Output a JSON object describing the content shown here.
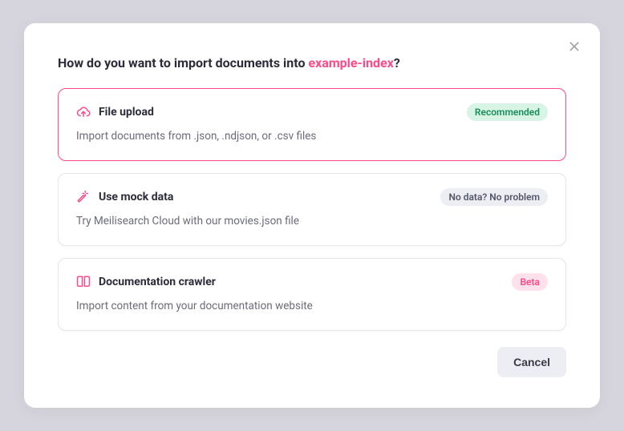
{
  "modal": {
    "title_prefix": "How do you want to import documents into ",
    "index_name": "example-index",
    "title_suffix": "?",
    "cancel_label": "Cancel"
  },
  "options": [
    {
      "title": "File upload",
      "description": "Import documents from .json, .ndjson, or .csv files",
      "badge": "Recommended",
      "selected": true
    },
    {
      "title": "Use mock data",
      "description": "Try Meilisearch Cloud with our movies.json file",
      "badge": "No data? No problem",
      "selected": false
    },
    {
      "title": "Documentation crawler",
      "description": "Import content from your documentation website",
      "badge": "Beta",
      "selected": false
    }
  ]
}
